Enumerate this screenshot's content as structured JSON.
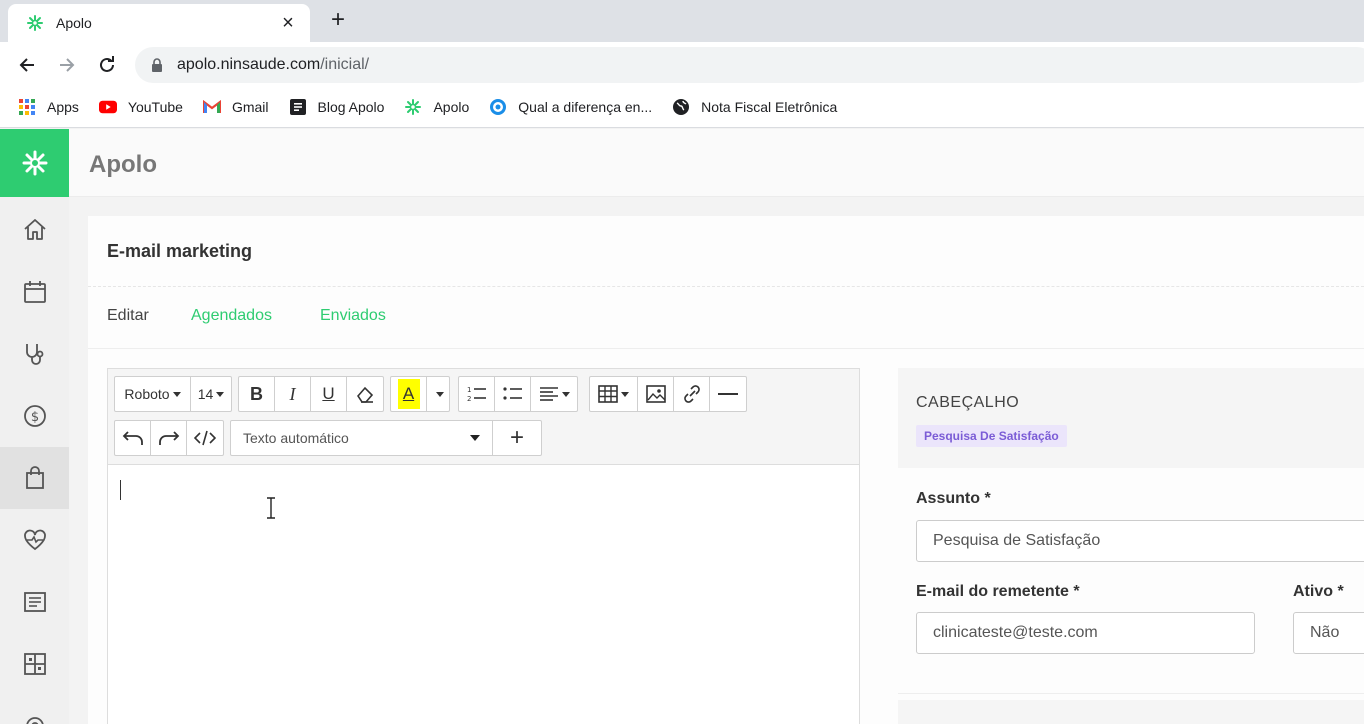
{
  "browser": {
    "tab_title": "Apolo",
    "tab_close": "×",
    "new_tab": "+",
    "url_domain": "apolo.ninsaude.com",
    "url_path": "/inicial/",
    "bookmarks": [
      {
        "label": "Apps",
        "icon": "apps-grid-icon"
      },
      {
        "label": "YouTube",
        "icon": "youtube-icon"
      },
      {
        "label": "Gmail",
        "icon": "gmail-icon"
      },
      {
        "label": "Blog Apolo",
        "icon": "blog-icon"
      },
      {
        "label": "Apolo",
        "icon": "apolo-logo-icon"
      },
      {
        "label": "Qual a diferença en...",
        "icon": "circle-target-icon"
      },
      {
        "label": "Nota Fiscal Eletrônica",
        "icon": "globe-icon"
      }
    ]
  },
  "app": {
    "name": "Apolo",
    "brand_color": "#2ecc71",
    "sidebar": [
      {
        "icon": "home-icon",
        "active": false
      },
      {
        "icon": "calendar-icon",
        "active": false
      },
      {
        "icon": "stethoscope-icon",
        "active": false
      },
      {
        "icon": "dollar-icon",
        "active": false
      },
      {
        "icon": "shopping-bag-icon",
        "active": true
      },
      {
        "icon": "heart-pulse-icon",
        "active": false
      },
      {
        "icon": "document-icon",
        "active": false
      },
      {
        "icon": "grid-icon",
        "active": false
      }
    ]
  },
  "page": {
    "title": "E-mail marketing",
    "tabs": [
      "Editar",
      "Agendados",
      "Enviados"
    ],
    "active_tab": "Editar"
  },
  "editor": {
    "font_family": "Roboto",
    "font_size": "14",
    "bold": "B",
    "italic": "I",
    "underline": "U",
    "highlight_letter": "A",
    "highlight_color": "#ffff00",
    "auto_text_select": "Texto automático",
    "add": "+"
  },
  "panel": {
    "header_label": "CABEÇALHO",
    "header_badge": "Pesquisa De Satisfação",
    "subject_label": "Assunto *",
    "subject_value": "Pesquisa de Satisfação",
    "sender_label": "E-mail do remetente *",
    "sender_value": "clinicateste@teste.com",
    "active_label": "Ativo *",
    "active_value": "Não"
  }
}
